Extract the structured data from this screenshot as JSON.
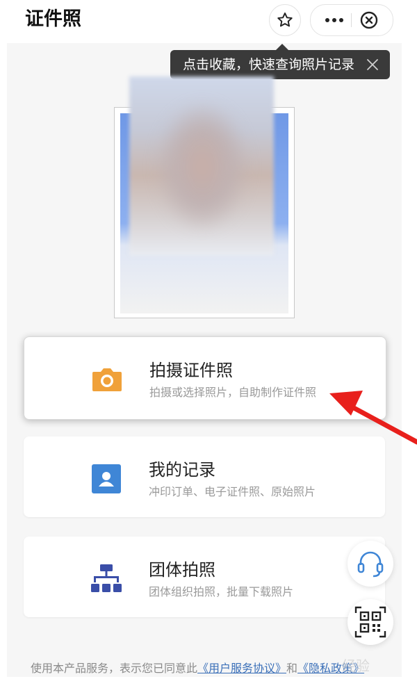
{
  "header": {
    "title": "证件照",
    "star_icon": "star-outline-icon",
    "more_icon": "more-dots-icon",
    "close_icon": "close-circle-icon"
  },
  "tooltip": {
    "text": "点击收藏，快速查询照片记录",
    "close_icon": "close-icon"
  },
  "photo": {
    "background_color": "#7aa0ea"
  },
  "cards": [
    {
      "icon": "camera-icon",
      "icon_color": "#f0a13a",
      "title": "拍摄证件照",
      "description": "拍摄或选择照片，自助制作证件照"
    },
    {
      "icon": "user-card-icon",
      "icon_color": "#3f86d6",
      "title": "我的记录",
      "description": "冲印订单、电子证件照、原始照片"
    },
    {
      "icon": "org-chart-icon",
      "icon_color": "#3a4ea8",
      "title": "团体拍照",
      "description": "团体组织拍照，批量下载照片"
    }
  ],
  "floating_buttons": {
    "service_icon": "headset-icon",
    "qr_icon": "qr-code-icon"
  },
  "footer": {
    "prefix": "使用本产品服务，表示您已同意此",
    "agreement_link": "《用户服务协议》",
    "connector": "和",
    "privacy_link": "《隐私政策》"
  },
  "watermark": {
    "text": "经验"
  },
  "colors": {
    "accent_orange": "#f0a13a",
    "accent_blue": "#3f86d6",
    "accent_navy": "#3a4ea8",
    "link": "#3a6fb8",
    "annotation_red": "#e8201c"
  }
}
